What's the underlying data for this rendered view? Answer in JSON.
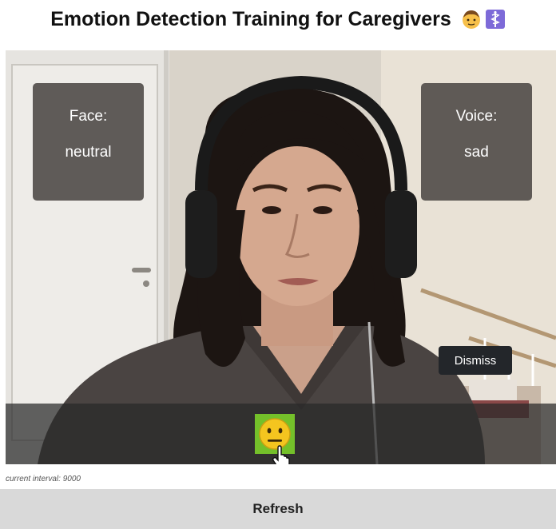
{
  "header": {
    "title": "Emotion Detection Training for Caregivers",
    "icons": [
      "person-emoji-icon",
      "medical-symbol-icon"
    ]
  },
  "video": {
    "face_panel": {
      "label": "Face:",
      "value": "neutral"
    },
    "voice_panel": {
      "label": "Voice:",
      "value": "sad"
    },
    "dismiss_label": "Dismiss",
    "emoji_button_icon": "neutral-face-icon",
    "emoji_button_color": "#74c02a"
  },
  "footer": {
    "interval_text": "current interval: 9000",
    "refresh_label": "Refresh"
  },
  "colors": {
    "panel_bg": "#54504c",
    "dismiss_bg": "#23262a",
    "refresh_bg": "#d9d9d9"
  }
}
